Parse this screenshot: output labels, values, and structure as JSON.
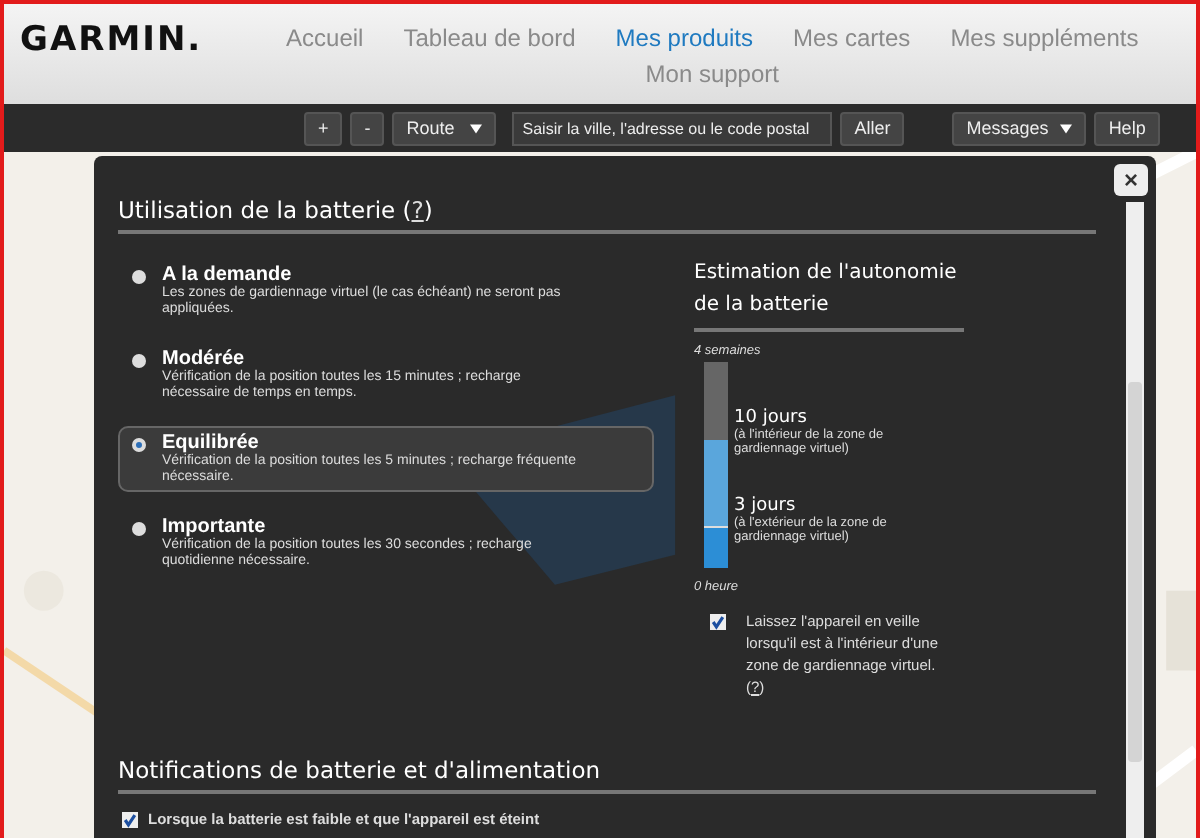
{
  "brand": "GARMIN.",
  "nav": [
    {
      "label": "Accueil",
      "selected": false
    },
    {
      "label": "Tableau de bord",
      "selected": false
    },
    {
      "label": "Mes produits",
      "selected": true
    },
    {
      "label": "Mes cartes",
      "selected": false
    },
    {
      "label": "Mes suppléments",
      "selected": false
    },
    {
      "label": "Mon support",
      "selected": false
    }
  ],
  "toolbar": {
    "zoom_in": "+",
    "zoom_out": "-",
    "map_type": "Route",
    "search": {
      "placeholder": "Saisir la ville, l'adresse ou le code postal"
    },
    "go": "Aller",
    "messages": "Messages",
    "help": "Help"
  },
  "dialog": {
    "close": "×",
    "battery": {
      "title": "Utilisation de la batterie (",
      "help": "?",
      "title_end": ")",
      "options": [
        {
          "label": "A la demande",
          "description": "Les zones de gardiennage virtuel (le cas échéant) ne seront pas appliquées.",
          "selected": false
        },
        {
          "label": "Modérée",
          "description": "Vérification de la position toutes les 15 minutes ; recharge nécessaire de temps en temps.",
          "selected": false
        },
        {
          "label": "Equilibrée",
          "description": "Vérification de la position toutes les 5 minutes ; recharge fréquente nécessaire.",
          "selected": true
        },
        {
          "label": "Importante",
          "description": "Vérification de la position toutes les 30 secondes ; recharge quotidienne nécessaire.",
          "selected": false
        }
      ]
    },
    "estimate": {
      "title": "Estimation de l'autonomie de la batterie",
      "top_label": "4 semaines",
      "bottom_label": "0 heure",
      "markers": [
        {
          "value": "10 jours",
          "note": "(à l'intérieur de la zone de gardiennage virtuel)",
          "level": 0.62
        },
        {
          "value": "3 jours",
          "note": "(à l'extérieur de la zone de gardiennage virtuel)",
          "level": 0.19
        }
      ],
      "standby": {
        "text": "Laissez l'appareil en veille lorsqu'il est à l'intérieur d'une zone de gardiennage virtuel. (",
        "help": "?",
        "text_end": ")",
        "checked": true
      }
    },
    "notifications": {
      "title": "Notifications de batterie et d'alimentation",
      "items": [
        {
          "label": "Lorsque la batterie est faible et que l'appareil est éteint",
          "checked": true
        }
      ]
    }
  }
}
